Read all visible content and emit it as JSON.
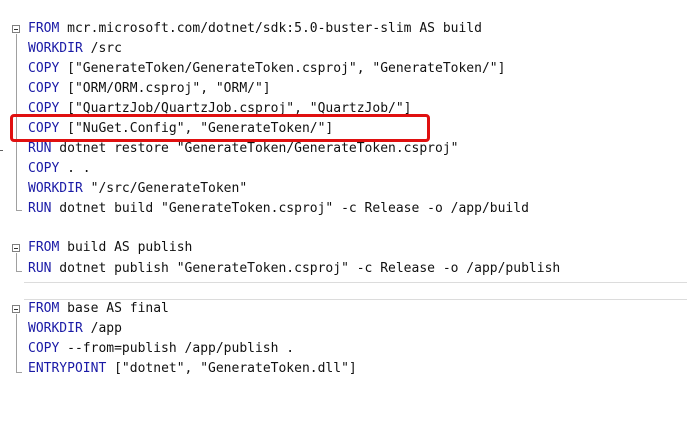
{
  "lines": [
    {
      "kw": "FROM",
      "rest": " mcr.microsoft.com/dotnet/sdk:5.0-buster-slim AS build"
    },
    {
      "kw": "WORKDIR",
      "rest": " /src"
    },
    {
      "kw": "COPY",
      "rest": " [\"GenerateToken/GenerateToken.csproj\", \"GenerateToken/\"]"
    },
    {
      "kw": "COPY",
      "rest": " [\"ORM/ORM.csproj\", \"ORM/\"]"
    },
    {
      "kw": "COPY",
      "rest": " [\"QuartzJob/QuartzJob.csproj\", \"QuartzJob/\"]"
    },
    {
      "kw": "COPY",
      "rest": " [\"NuGet.Config\", \"GenerateToken/\"]"
    },
    {
      "kw": "RUN",
      "rest": " dotnet restore \"GenerateToken/GenerateToken.csproj\""
    },
    {
      "kw": "COPY",
      "rest": " . ."
    },
    {
      "kw": "WORKDIR",
      "rest": " \"/src/GenerateToken\""
    },
    {
      "kw": "RUN",
      "rest": " dotnet build \"GenerateToken.csproj\" -c Release -o /app/build"
    },
    {
      "kw": "FROM",
      "rest": " build AS publish"
    },
    {
      "kw": "RUN",
      "rest": " dotnet publish \"GenerateToken.csproj\" -c Release -o /app/publish"
    },
    {
      "kw": "FROM",
      "rest": " base AS final"
    },
    {
      "kw": "WORKDIR",
      "rest": " /app"
    },
    {
      "kw": "COPY",
      "rest": " --from=publish /app/publish ."
    },
    {
      "kw": "ENTRYPOINT",
      "rest": " [\"dotnet\", \"GenerateToken.dll\"]"
    }
  ],
  "colors": {
    "keyword": "#1a1aa6",
    "highlight_border": "#e01010"
  }
}
